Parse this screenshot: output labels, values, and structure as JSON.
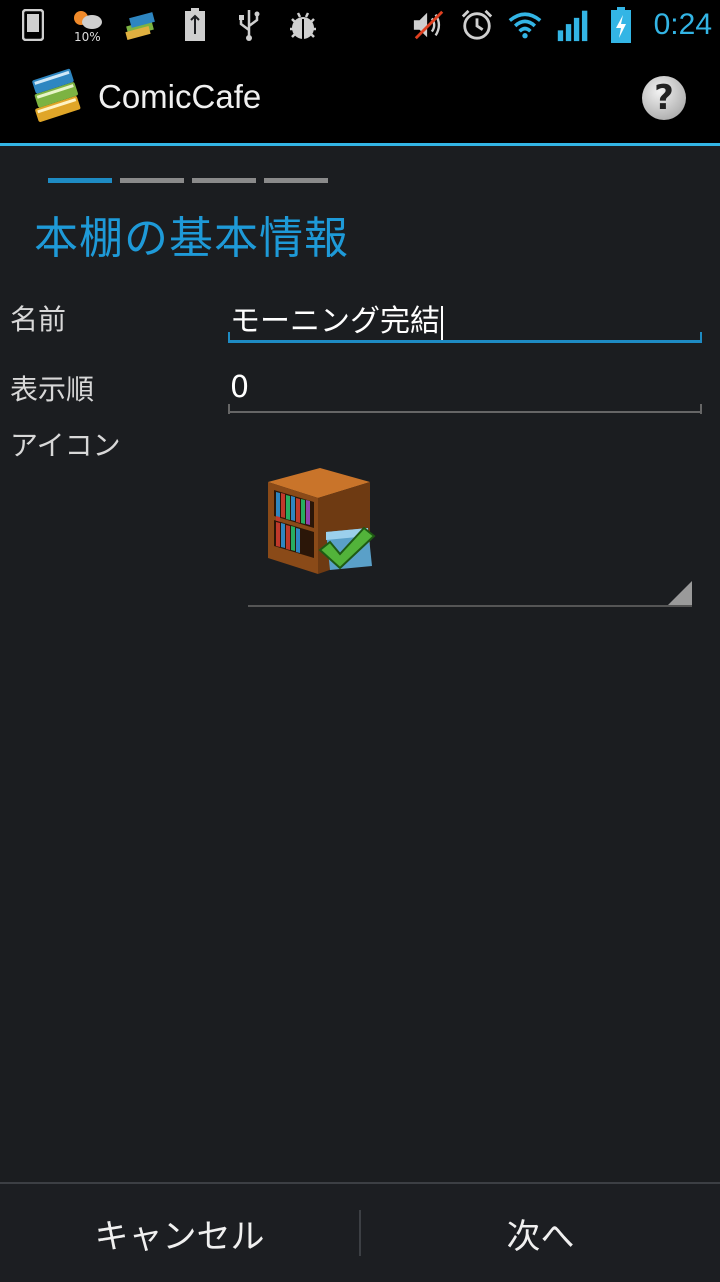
{
  "status_bar": {
    "time": "0:24",
    "weather_temp": "10%",
    "icons": [
      "phone-icon",
      "weather-icon",
      "comiccafe-notification-icon",
      "battery-usb-icon",
      "usb-icon",
      "debug-bug-icon",
      "mute-icon",
      "alarm-icon",
      "wifi-icon",
      "signal-icon",
      "battery-charging-icon"
    ]
  },
  "action_bar": {
    "title": "ComicCafe",
    "help_label": "?"
  },
  "wizard": {
    "current_step": 1,
    "total_steps": 4
  },
  "form": {
    "section_title": "本棚の基本情報",
    "name_label": "名前",
    "name_value": "モーニング完結",
    "order_label": "表示順",
    "order_value": "0",
    "icon_label": "アイコン",
    "icon_name": "bookshelf-icon"
  },
  "buttons": {
    "cancel": "キャンセル",
    "next": "次へ"
  },
  "colors": {
    "accent": "#33b5e5",
    "title": "#1e9ad8",
    "background": "#1b1d20"
  }
}
